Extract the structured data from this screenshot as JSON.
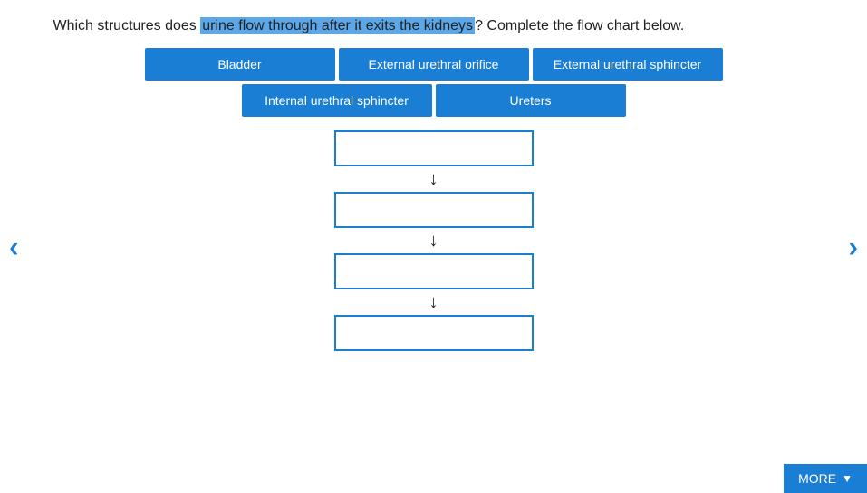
{
  "question": {
    "prefix": "Which structures does ",
    "highlight": "urine flow through after it exits the kidneys",
    "suffix": "? Complete the flow chart below."
  },
  "options": {
    "row1": [
      {
        "label": "Bladder",
        "id": "bladder"
      },
      {
        "label": "External urethral orifice",
        "id": "ext-urethral-orifice"
      },
      {
        "label": "External urethral sphincter",
        "id": "ext-urethral-sphincter"
      }
    ],
    "row2": [
      {
        "label": "Internal urethral sphincter",
        "id": "int-urethral-sphincter"
      },
      {
        "label": "Ureters",
        "id": "ureters"
      }
    ]
  },
  "flowchart": {
    "boxes": [
      {
        "id": "box1",
        "label": ""
      },
      {
        "id": "box2",
        "label": ""
      },
      {
        "id": "box3",
        "label": ""
      },
      {
        "id": "box4",
        "label": ""
      }
    ]
  },
  "nav": {
    "prev": "‹",
    "next": "›"
  },
  "more_button": {
    "label": "MORE",
    "arrow": "▼"
  }
}
